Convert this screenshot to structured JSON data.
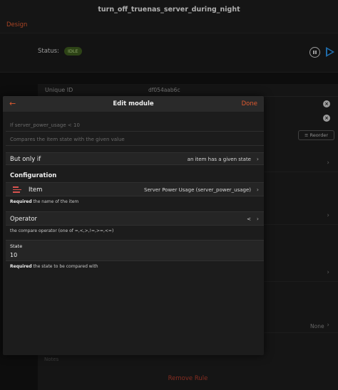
{
  "window": {
    "title": "turn_off_truenas_server_during_night",
    "tab_design": "Design"
  },
  "status": {
    "label": "Status:",
    "badge": "IDLE"
  },
  "background": {
    "uid_label": "Unique ID",
    "uid_value": "df054aab6c",
    "reorder_label": "Reorder",
    "none_label": "None",
    "notes_label": "Notes",
    "remove_rule_label": "Remove Rule"
  },
  "modal": {
    "back_glyph": "←",
    "title": "Edit module",
    "done_label": "Done",
    "name_placeholder": "If server_power_usage < 10",
    "description_placeholder": "Compares the item state with the given value",
    "but_only_if": {
      "label": "But only if",
      "value": "an item has a given state"
    },
    "configuration_heading": "Configuration",
    "item": {
      "label": "Item",
      "value": "Server Power Usage (server_power_usage)",
      "hint_bold": "Required",
      "hint": " the name of the item"
    },
    "operator": {
      "label": "Operator",
      "value": "<",
      "hint": "the compare operator (one of =,<,>,!=,>=,<=)"
    },
    "state": {
      "label": "State",
      "value": "10",
      "hint_bold": "Required",
      "hint": " the state to be compared with"
    }
  },
  "icons": {
    "chevron": "›",
    "close": "×"
  },
  "colors": {
    "accent": "#e05a30",
    "play": "#2b8fe0",
    "badge_bg": "#3c5a1e",
    "danger": "#b13b2c"
  }
}
